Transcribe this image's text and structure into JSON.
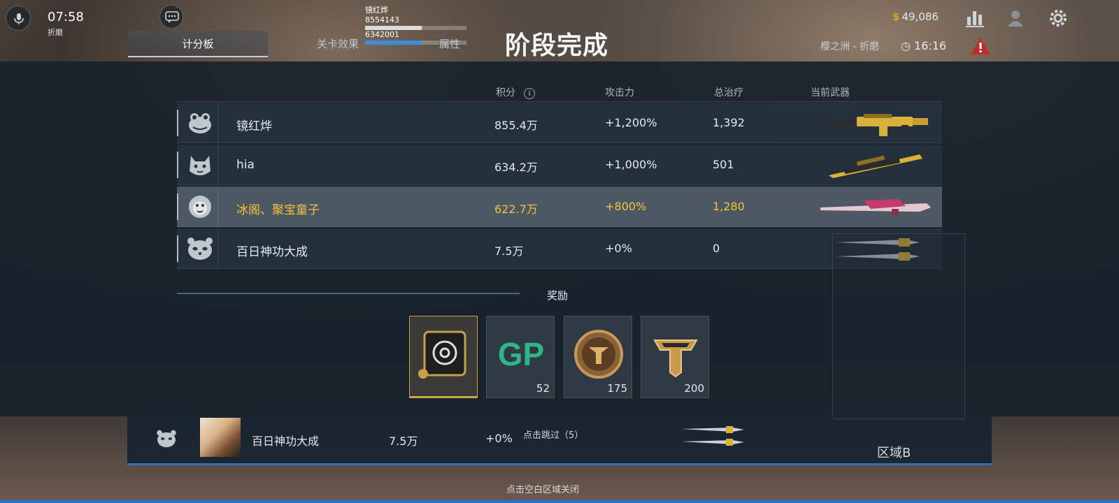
{
  "hud": {
    "time": "07:58",
    "mode": "折磨",
    "top_player_name": "镜红烨",
    "top_player_score": "8554143",
    "second_score": "6342001",
    "coins": "49,086",
    "map_name": "樱之洲 - 折磨",
    "timer": "16:16"
  },
  "tabs": [
    "计分板",
    "关卡效果",
    "属性"
  ],
  "title": "阶段完成",
  "headers": {
    "score": "积分",
    "attack": "攻击力",
    "heal": "总治疗",
    "weapon": "当前武器",
    "info": "i"
  },
  "players": [
    {
      "name": "镜红烨",
      "score": "855.4万",
      "attack": "+1,200%",
      "heal": "1,392",
      "avatar": "frog-avatar-icon",
      "weapon": "gold-rifle"
    },
    {
      "name": "hia",
      "score": "634.2万",
      "attack": "+1,000%",
      "heal": "501",
      "avatar": "cat-avatar-icon",
      "weapon": "gold-sniper"
    },
    {
      "name": "冰阁、聚宝童子",
      "score": "622.7万",
      "attack": "+800%",
      "heal": "1,280",
      "avatar": "monkey-avatar-icon",
      "weapon": "pink-rifle",
      "highlight": true
    },
    {
      "name": "百日神功大成",
      "score": "7.5万",
      "attack": "+0%",
      "heal": "0",
      "avatar": "panda-avatar-icon",
      "weapon": "twin-daggers"
    }
  ],
  "rewards_title": "奖励",
  "rewards": [
    {
      "icon": "emblem-card-icon",
      "count": ""
    },
    {
      "icon": "gp-icon",
      "count": "52"
    },
    {
      "icon": "bronze-medal-icon",
      "count": "175"
    },
    {
      "icon": "rank-badge-icon",
      "count": "200"
    }
  ],
  "under_row": {
    "name": "百日神功大成",
    "score": "7.5万",
    "percent": "+0%",
    "skip": "点击跳过（5）",
    "zone": "区域B"
  },
  "hint": "点击空白区域关闭",
  "colors": {
    "highlight": "#f4c33a",
    "panel": "#18222c",
    "accent_blue": "#2a6fd0"
  }
}
